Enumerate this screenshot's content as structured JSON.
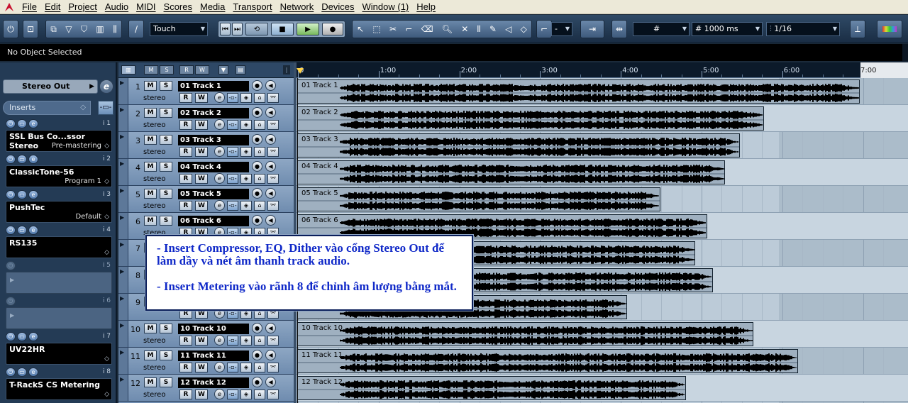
{
  "menu": [
    "File",
    "Edit",
    "Project",
    "Audio",
    "MIDI",
    "Scores",
    "Media",
    "Transport",
    "Network",
    "Devices",
    "Window (1)",
    "Help"
  ],
  "toolbar": {
    "automation_mode": "Touch",
    "snap_type": "-",
    "grid_type": "#",
    "quantize_length": "1000 ms",
    "quantize": "1/16",
    "icons": [
      "power-icon",
      "constrain-icon",
      "sync-icon",
      "pointer-icon",
      "range-icon",
      "split-icon",
      "glue-icon",
      "erase-icon",
      "zoom-icon",
      "mute-icon",
      "time-warp-icon",
      "draw-icon",
      "play-tool-icon"
    ]
  },
  "info_line": "No Object Selected",
  "inspector": {
    "output": "Stereo Out",
    "inserts_label": "Inserts",
    "slots": [
      {
        "number": "i 1",
        "plugin": "SSL Bus Co...ssor Stereo",
        "preset": "Pre-mastering",
        "active": true
      },
      {
        "number": "i 2",
        "plugin": "ClassicTone-56",
        "preset": "Program 1",
        "active": true
      },
      {
        "number": "i 3",
        "plugin": "PushTec",
        "preset": "Default",
        "active": true
      },
      {
        "number": "i 4",
        "plugin": "RS135",
        "preset": "",
        "active": true
      },
      {
        "number": "i 5",
        "plugin": "",
        "preset": "",
        "active": false
      },
      {
        "number": "i 6",
        "plugin": "",
        "preset": "",
        "active": false
      },
      {
        "number": "i 7",
        "plugin": "UV22HR",
        "preset": "",
        "active": true
      },
      {
        "number": "i 8",
        "plugin": "T-RackS CS Metering",
        "preset": "",
        "active": true
      }
    ]
  },
  "ruler": {
    "labels": [
      "0",
      "1:00",
      "2:00",
      "3:00",
      "4:00",
      "5:00",
      "6:00",
      "7:00"
    ]
  },
  "tracks": [
    {
      "num": "1",
      "name": "01 Track 1",
      "channel": "stereo",
      "event": "01 Track 1",
      "length_sec": 418
    },
    {
      "num": "2",
      "name": "02 Track 2",
      "channel": "stereo",
      "event": "02 Track 2",
      "length_sec": 347
    },
    {
      "num": "3",
      "name": "03 Track 3",
      "channel": "stereo",
      "event": "03 Track 3",
      "length_sec": 329
    },
    {
      "num": "4",
      "name": "04 Track 4",
      "channel": "stereo",
      "event": "04 Track 4",
      "length_sec": 318
    },
    {
      "num": "5",
      "name": "05 Track 5",
      "channel": "stereo",
      "event": "05 Track 5",
      "length_sec": 270
    },
    {
      "num": "6",
      "name": "06 Track 6",
      "channel": "stereo",
      "event": "06 Track 6",
      "length_sec": 305
    },
    {
      "num": "7",
      "name": "",
      "channel": "",
      "event": "",
      "length_sec": 296
    },
    {
      "num": "8",
      "name": "",
      "channel": "",
      "event": "",
      "length_sec": 309
    },
    {
      "num": "9",
      "name": "",
      "channel": "",
      "event": "",
      "length_sec": 245
    },
    {
      "num": "10",
      "name": "10 Track 10",
      "channel": "stereo",
      "event": "10 Track 10",
      "length_sec": 339
    },
    {
      "num": "11",
      "name": "11 Track 11",
      "channel": "stereo",
      "event": "11 Track 11",
      "length_sec": 372
    },
    {
      "num": "12",
      "name": "12 Track 12",
      "channel": "stereo",
      "event": "12 Track 12",
      "length_sec": 289
    }
  ],
  "track_buttons": {
    "mute": "M",
    "solo": "S",
    "read": "R",
    "write": "W",
    "edit": "e"
  },
  "annotation": {
    "line1": "- Insert Compressor, EQ, Dither vào cổng Stereo Out để làm dầy và nét âm thanh track audio.",
    "line2": "- Insert Metering vào rãnh 8 để chỉnh âm lượng bằng mắt."
  }
}
